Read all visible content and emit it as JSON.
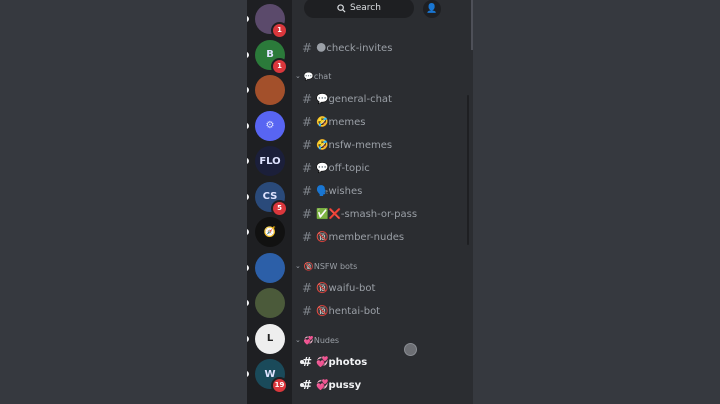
{
  "search": {
    "label": "Search"
  },
  "servers": [
    {
      "name": "anime-avatar",
      "badge": "1",
      "color": "#5b4a6b",
      "glyph": ""
    },
    {
      "name": "b-logo",
      "badge": "1",
      "color": "#2b7a3a",
      "glyph": "B"
    },
    {
      "name": "cartoon",
      "badge": "",
      "color": "#a3502b",
      "glyph": ""
    },
    {
      "name": "discord-gear",
      "badge": "",
      "color": "#5865f2",
      "glyph": "⚙"
    },
    {
      "name": "flo",
      "badge": "",
      "color": "#1b1f3a",
      "glyph": "FLO"
    },
    {
      "name": "cs",
      "badge": "5",
      "color": "#2a4a7a",
      "glyph": "CS"
    },
    {
      "name": "compass",
      "badge": "",
      "color": "#111",
      "glyph": "🧭"
    },
    {
      "name": "anime2",
      "badge": "",
      "color": "#2c5fa8",
      "glyph": ""
    },
    {
      "name": "seal",
      "badge": "",
      "color": "#4b5a3a",
      "glyph": ""
    },
    {
      "name": "lr",
      "badge": "",
      "color": "#eeeeee",
      "glyph": "L"
    },
    {
      "name": "w",
      "badge": "19",
      "color": "#1a4a5a",
      "glyph": "W"
    }
  ],
  "channels": {
    "top": {
      "label": "🌑check-invites"
    },
    "cat_chat": "💬chat",
    "chat": [
      {
        "label": "💬general-chat"
      },
      {
        "label": "🤣memes"
      },
      {
        "label": "🤣nsfw-memes"
      },
      {
        "label": "💬off-topic"
      },
      {
        "label": "🗣️wishes"
      },
      {
        "label": "✅❌-smash-or-pass"
      },
      {
        "label": "🔞member-nudes"
      }
    ],
    "cat_bots": "🔞NSFW bots",
    "bots": [
      {
        "label": "🔞waifu-bot"
      },
      {
        "label": "🔞hentai-bot"
      }
    ],
    "cat_nudes": "💞Nudes",
    "nudes": [
      {
        "label": "💞photos"
      },
      {
        "label": "💞pussy"
      }
    ]
  }
}
